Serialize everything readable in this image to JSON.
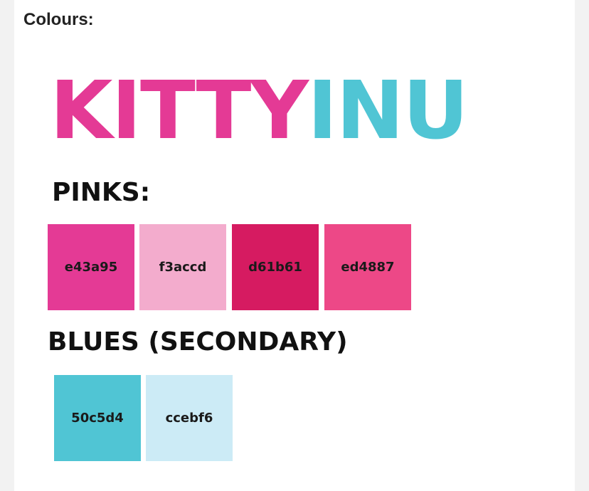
{
  "heading": "Colours:",
  "logo": {
    "part1": "KITTY",
    "part2": "INU",
    "part1_color": "#e43a95",
    "part2_color": "#50c5d4"
  },
  "pinks": {
    "title": "PINKS:",
    "swatches": [
      {
        "label": "e43a95",
        "color": "#e43a95"
      },
      {
        "label": "f3accd",
        "color": "#f3accd"
      },
      {
        "label": "d61b61",
        "color": "#d61b61"
      },
      {
        "label": "ed4887",
        "color": "#ed4887"
      }
    ]
  },
  "blues": {
    "title": "BLUES (SECONDARY)",
    "swatches": [
      {
        "label": "50c5d4",
        "color": "#50c5d4"
      },
      {
        "label": "ccebf6",
        "color": "#ccebf6"
      }
    ]
  }
}
